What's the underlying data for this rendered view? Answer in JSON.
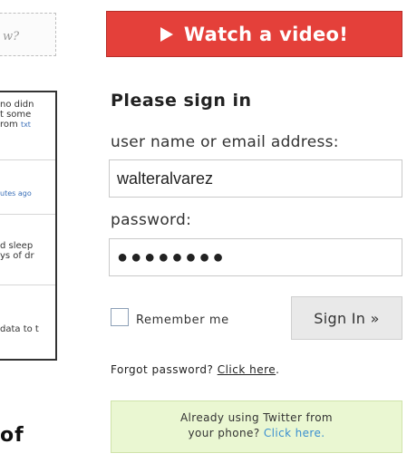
{
  "left": {
    "search_fragment": "w?",
    "feed": [
      {
        "lines": [
          "no didn",
          "t some",
          "rom "
        ],
        "link": "txt"
      },
      {
        "lines": [],
        "link": "utes ago"
      },
      {
        "lines": [
          "d sleep",
          "ys of dr"
        ],
        "link": ""
      },
      {
        "lines": [
          "data to t"
        ],
        "link": ""
      }
    ],
    "bottom_fragment": "of"
  },
  "watch": {
    "label": "Watch a video!",
    "icon": "play-icon"
  },
  "signin": {
    "title": "Please sign in",
    "username_label": "user name or email address:",
    "username_value": "walteralvarez",
    "password_label": "password:",
    "password_value": "●●●●●●●●",
    "remember_label": "Remember me",
    "remember_checked": false,
    "button_label": "Sign In »",
    "forgot_text": "Forgot password?",
    "forgot_link": "Click here",
    "forgot_end": "."
  },
  "twitter_note": {
    "line1": "Already using Twitter from",
    "line2": "your phone?",
    "link": "Click here."
  },
  "colors": {
    "accent_red": "#e4403a",
    "note_green": "#eaf7d2",
    "link_blue": "#3a8fd0"
  }
}
